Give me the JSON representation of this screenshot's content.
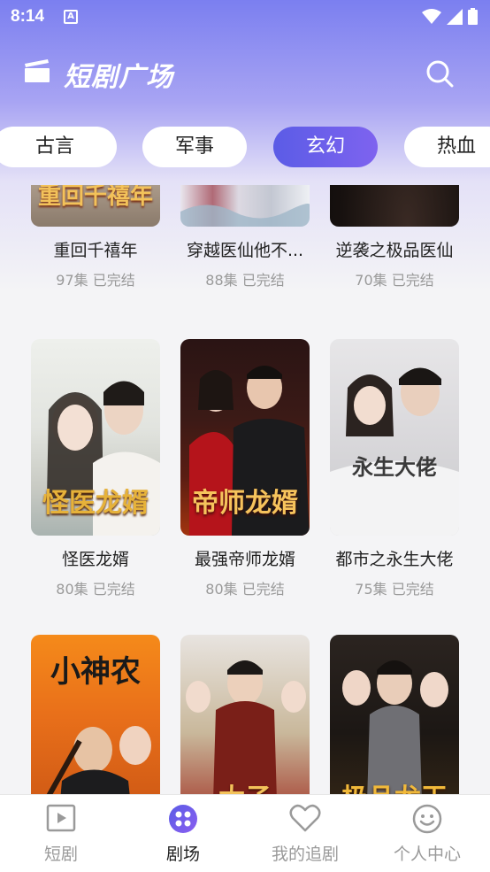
{
  "status_bar": {
    "time": "8:14",
    "badge": "A"
  },
  "header": {
    "title": "短剧广场"
  },
  "tabs": [
    {
      "label": "古言",
      "active": false
    },
    {
      "label": "军事",
      "active": false
    },
    {
      "label": "玄幻",
      "active": true
    },
    {
      "label": "热血",
      "active": false
    }
  ],
  "dramas": [
    {
      "title": "重回千禧年",
      "meta": "97集 已完结",
      "poster_text": "重回千禧年"
    },
    {
      "title": "穿越医仙他不...",
      "meta": "88集 已完结",
      "poster_text": ""
    },
    {
      "title": "逆袭之极品医仙",
      "meta": "70集 已完结",
      "poster_text": ""
    },
    {
      "title": "怪医龙婿",
      "meta": "80集 已完结",
      "poster_text": "怪医龙婿"
    },
    {
      "title": "最强帝师龙婿",
      "meta": "80集 已完结",
      "poster_text": "帝师龙婿"
    },
    {
      "title": "都市之永生大佬",
      "meta": "75集 已完结",
      "poster_text": "永生大佬"
    },
    {
      "title": "",
      "meta": "",
      "poster_text": "小神农"
    },
    {
      "title": "",
      "meta": "",
      "poster_text": "太子"
    },
    {
      "title": "",
      "meta": "",
      "poster_text": "极品龙王"
    }
  ],
  "bottom_nav": [
    {
      "label": "短剧",
      "icon": "play-icon",
      "active": false
    },
    {
      "label": "剧场",
      "icon": "theater-icon",
      "active": true
    },
    {
      "label": "我的追剧",
      "icon": "heart-icon",
      "active": false
    },
    {
      "label": "个人中心",
      "icon": "smile-icon",
      "active": false
    }
  ],
  "colors": {
    "accent": "#6a5fea",
    "header_top": "#7b7ff0"
  }
}
